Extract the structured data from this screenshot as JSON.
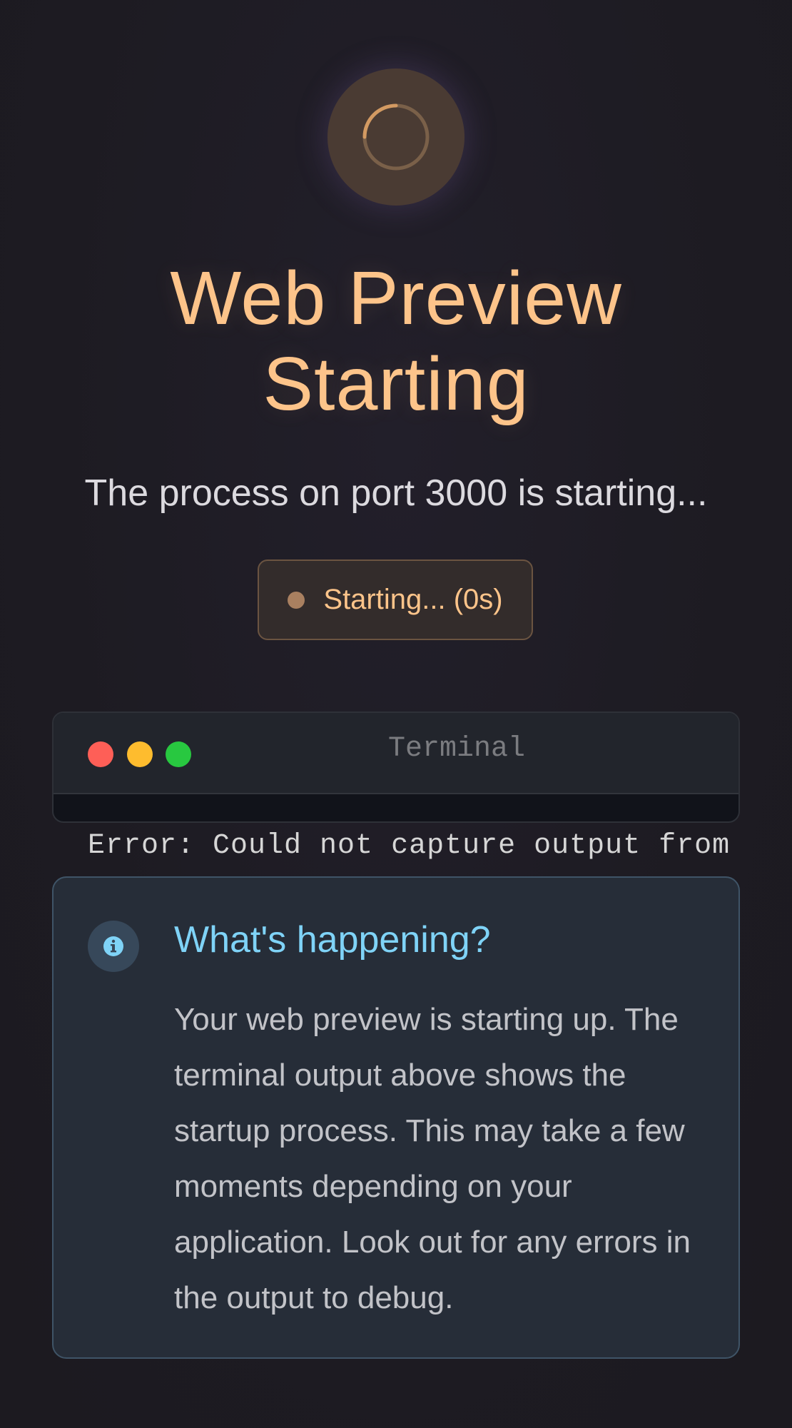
{
  "spinner": {
    "icon": "loading-spinner-icon"
  },
  "title": {
    "line1": "Web Preview",
    "line2": "Starting"
  },
  "subtitle": "The process on port 3000 is starting...",
  "status": {
    "label": "Starting... (0s)",
    "dot_color": "#a98060"
  },
  "terminal": {
    "title": "Terminal",
    "output": "Error: Could not capture output from"
  },
  "info": {
    "icon": "info-icon",
    "heading": "What's happening?",
    "body": "Your web preview is starting up. The terminal output above shows the startup process. This may take a few moments depending on your application. Look out for any errors in the output to debug."
  },
  "colors": {
    "accent": "#fdc48a",
    "info_accent": "#7fd3f7",
    "background": "#1d1b22"
  }
}
